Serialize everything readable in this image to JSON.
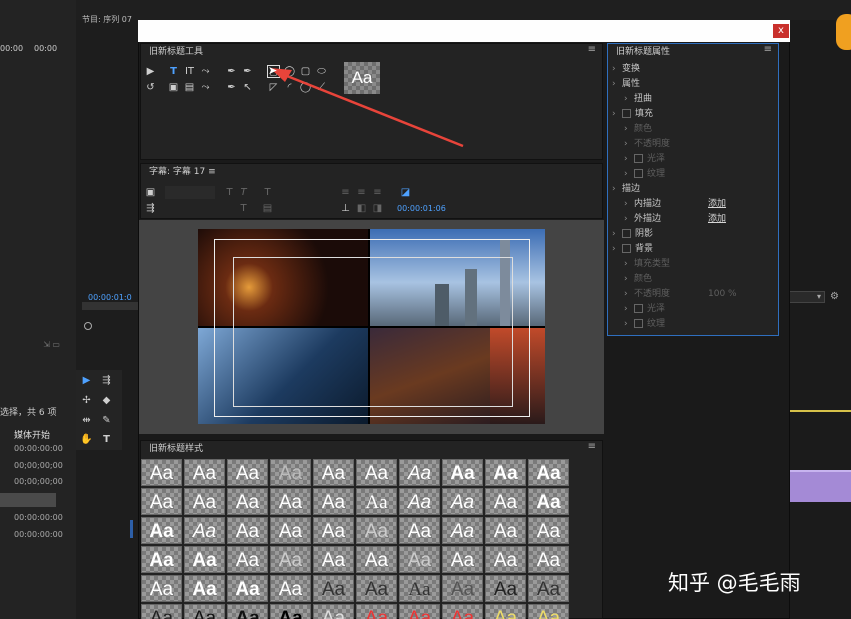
{
  "app": {
    "program_monitor_label": "节目: 序列 07",
    "timecode_top_a": "00:00",
    "timecode_top_b": "00:00",
    "program_timecode": "00:00:01:0",
    "selection_info": "选择，共 6 项",
    "media_start_header": "媒体开始",
    "media_rows": [
      "00:00:00:00",
      "00;00;00;00",
      "00;00;00;00",
      "",
      "00:00:00:00",
      "00:00:00:00"
    ]
  },
  "dialog": {
    "close_glyph": "x",
    "tools_panel": {
      "title": "旧新标题工具",
      "menu_glyph": "≡"
    },
    "titler_panel": {
      "title": "字幕: 字幕 17",
      "menu_glyph": "≡",
      "timecode": "00:00:01:06"
    },
    "styles_panel": {
      "title": "旧新标题样式",
      "menu_glyph": "≡"
    },
    "properties_panel": {
      "title": "旧新标题属性",
      "menu_glyph": "≡",
      "rows": [
        {
          "label": "变换",
          "indent": 0,
          "type": "chevron"
        },
        {
          "label": "属性",
          "indent": 0,
          "type": "chevron"
        },
        {
          "label": "扭曲",
          "indent": 1,
          "type": "chevron"
        },
        {
          "label": "填充",
          "indent": 0,
          "type": "checkbox"
        },
        {
          "label": "颜色",
          "indent": 1,
          "type": "dim"
        },
        {
          "label": "不透明度",
          "indent": 1,
          "type": "dim"
        },
        {
          "label": "光泽",
          "indent": 1,
          "type": "dim-checkbox"
        },
        {
          "label": "纹理",
          "indent": 1,
          "type": "dim-checkbox"
        },
        {
          "label": "描边",
          "indent": 0,
          "type": "chevron"
        },
        {
          "label": "内描边",
          "indent": 1,
          "type": "chevron",
          "link": "添加"
        },
        {
          "label": "外描边",
          "indent": 1,
          "type": "chevron",
          "link": "添加"
        },
        {
          "label": "阴影",
          "indent": 0,
          "type": "checkbox"
        },
        {
          "label": "背景",
          "indent": 0,
          "type": "checkbox"
        },
        {
          "label": "填充类型",
          "indent": 1,
          "type": "dim"
        },
        {
          "label": "颜色",
          "indent": 1,
          "type": "dim"
        },
        {
          "label": "不透明度",
          "indent": 1,
          "type": "dim",
          "value": "100 %"
        },
        {
          "label": "光泽",
          "indent": 1,
          "type": "dim-checkbox"
        },
        {
          "label": "纹理",
          "indent": 1,
          "type": "dim-checkbox"
        }
      ]
    }
  },
  "style_swatch_text": "Aa",
  "watermark": "知乎 @毛毛雨",
  "colors": {
    "accent": "#4ea1ff",
    "arrow": "#e8443a",
    "highlight_clip": "#a48ad6"
  }
}
